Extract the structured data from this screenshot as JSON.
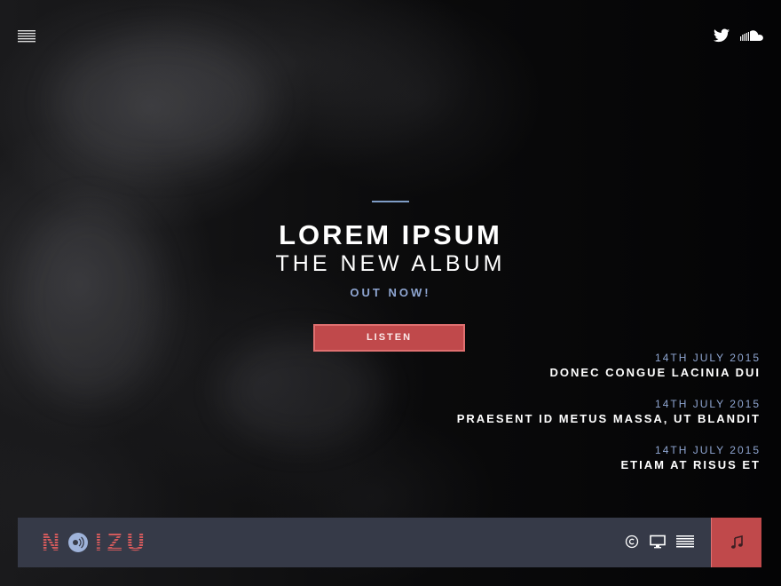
{
  "header": {
    "menu_icon": "hamburger-menu-icon",
    "social": [
      {
        "name": "twitter",
        "icon": "twitter-icon"
      },
      {
        "name": "soundcloud",
        "icon": "soundcloud-icon"
      }
    ]
  },
  "hero": {
    "title": "LOREM IPSUM",
    "subtitle": "THE NEW ALBUM",
    "tagline": "OUT NOW!",
    "cta_label": "LISTEN"
  },
  "news": [
    {
      "date": "14TH JULY 2015",
      "title": "DONEC CONGUE LACINIA DUI"
    },
    {
      "date": "14TH JULY 2015",
      "title": "PRAESENT ID METUS MASSA, UT BLANDIT"
    },
    {
      "date": "14TH JULY 2015",
      "title": "ETIAM AT RISUS ET"
    }
  ],
  "footer": {
    "logo_text": "NOIZU",
    "icons": [
      "copyright-icon",
      "monitor-icon",
      "list-icon"
    ],
    "music_icon": "music-note-icon"
  },
  "colors": {
    "accent_red": "#c0494b",
    "accent_blue": "#8fa6d2",
    "footer_bg": "#363a48",
    "background": "#050506"
  }
}
